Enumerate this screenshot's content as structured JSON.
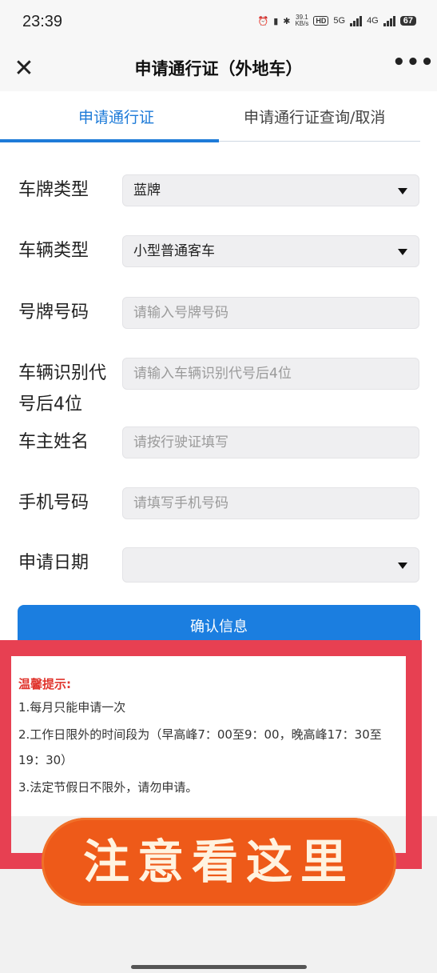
{
  "status": {
    "time": "23:39",
    "speed_top": "39.1",
    "speed_unit": "KB/s",
    "tag_hd": "HD",
    "tag_5g": "5G",
    "tag_4g": "4G",
    "battery": "67"
  },
  "header": {
    "close_glyph": "✕",
    "title": "申请通行证（外地车）",
    "more_glyph": "•••"
  },
  "tabs": [
    {
      "label": "申请通行证",
      "active": true
    },
    {
      "label": "申请通行证查询/取消",
      "active": false
    }
  ],
  "form": {
    "plate_type": {
      "label": "车牌类型",
      "value": "蓝牌"
    },
    "vehicle_type": {
      "label": "车辆类型",
      "value": "小型普通客车"
    },
    "plate_number": {
      "label": "号牌号码",
      "placeholder": "请输入号牌号码"
    },
    "vin_last4": {
      "label_line1": "车辆识别代",
      "label_line2": "号后4位",
      "placeholder": "请输入车辆识别代号后4位"
    },
    "owner_name": {
      "label": "车主姓名",
      "placeholder": "请按行驶证填写"
    },
    "phone": {
      "label": "手机号码",
      "placeholder": "请填写手机号码"
    },
    "apply_date": {
      "label": "申请日期",
      "value": ""
    },
    "confirm_label": "确认信息"
  },
  "notice": {
    "title": "温馨提示:",
    "lines": [
      "1.每月只能申请一次",
      "2.工作日限外的时间段为（早高峰7：00至9：00，晚高峰17：30至",
      "19：30）",
      "3.法定节假日不限外，请勿申请。"
    ]
  },
  "overlay": {
    "sticker_text": "注意看这里",
    "frame_color": "#e74052",
    "sticker_color": "#ee5a19"
  },
  "colors": {
    "accent": "#1e7bd8",
    "warning": "#e0342c"
  }
}
